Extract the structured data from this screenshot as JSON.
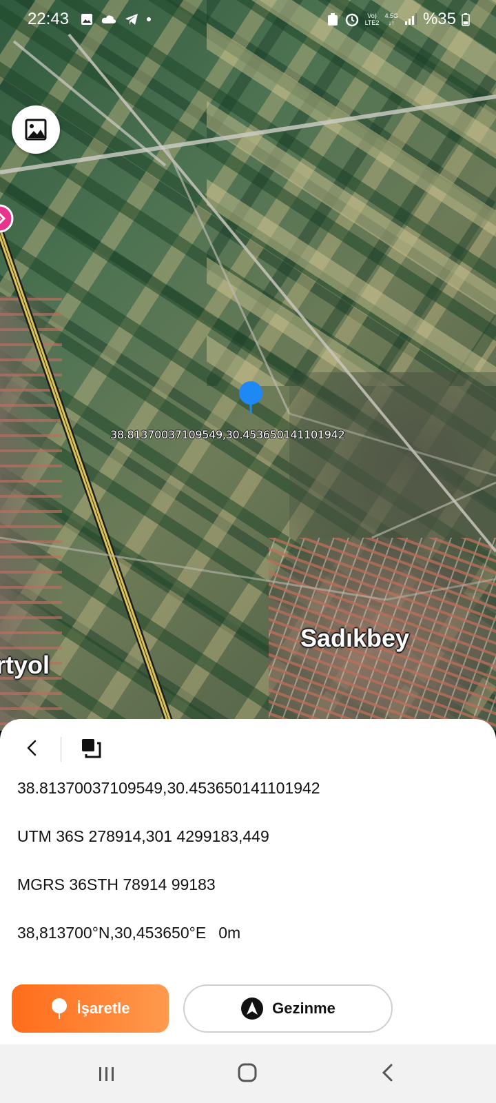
{
  "status_bar": {
    "time": "22:43",
    "network_top": "Vo)",
    "network_bottom": "LTE2",
    "network_gen": "4.5G",
    "battery": "%35"
  },
  "map": {
    "marker_coordinate_label": "38.81370037109549,30.453650141101942",
    "places": {
      "town": "Sadıkbey",
      "partial_town": "rtyol"
    }
  },
  "sheet": {
    "lat_lng": "38.81370037109549,30.453650141101942",
    "utm": "UTM 36S 278914,301 4299183,449",
    "mgrs": "MGRS 36STH 78914 99183",
    "dms": "38,813700°N,30,453650°E",
    "altitude": "0m",
    "mark_label": "İşaretle",
    "navigate_label": "Gezinme"
  },
  "colors": {
    "accent_orange": "#ff7a26",
    "pin_blue": "#1e88f5",
    "poi_pink": "#e8348c"
  },
  "icons": {
    "layer": "image-icon",
    "back": "chevron-left-icon",
    "copy": "copy-icon",
    "mark": "pin-icon",
    "navigate": "navigation-arrow-icon"
  }
}
